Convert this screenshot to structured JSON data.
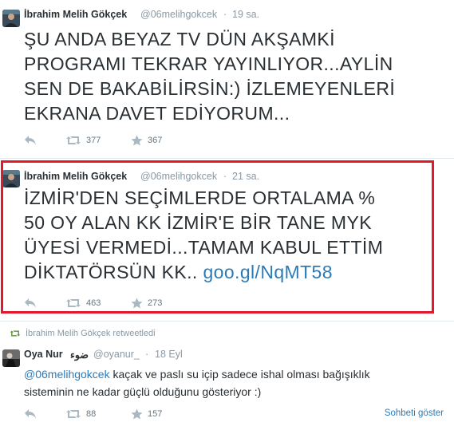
{
  "tweets": [
    {
      "name": "İbrahim Melih Gökçek",
      "handle": "@06melihgokcek",
      "dot": "·",
      "time": "19 sa.",
      "text_lines": [
        "ŞU ANDA BEYAZ TV DÜN AKŞAMKİ",
        "PROGRAMI TEKRAR YAYINLIYOR...AYLİN",
        "SEN DE BAKABİLİRSİN:) İZLEMEYENLERİ",
        "EKRANA DAVET EDİYORUM..."
      ],
      "retweets": "377",
      "favorites": "367"
    },
    {
      "name": "İbrahim Melih Gökçek",
      "handle": "@06melihgokcek",
      "dot": "·",
      "time": "21 sa.",
      "text_lines": [
        "İZMİR'DEN SEÇİMLERDE ORTALAMA %",
        "50 OY ALAN KK İZMİR'E BİR TANE MYK",
        "ÜYESİ VERMEDİ...TAMAM KABUL ETTİM",
        "DİKTATÖRSÜN KK.. "
      ],
      "link": "goo.gl/NqMT58",
      "retweets": "463",
      "favorites": "273"
    },
    {
      "retweeted_by": "İbrahim Melih Gökçek retweetledi",
      "name": "Oya Nur",
      "name_extra": "ضوء",
      "handle": "@oyanur_",
      "dot": "·",
      "time": "18 Eyl",
      "mention": "@06melihgokcek",
      "text_line1_rest": " kaçak ve paslı su içip sadece ishal olması bağışıklık",
      "text_line2": "sisteminin ne kadar güçlü olduğunu gösteriyor :)",
      "retweets": "88",
      "favorites": "157",
      "view_conversation": "Sohbeti göster"
    }
  ],
  "icons": [
    "reply-icon",
    "retweet-icon",
    "favorite-icon"
  ],
  "colors": {
    "highlight_border": "#e3182d",
    "link": "#2b7bb9",
    "meta": "#8899a6"
  }
}
